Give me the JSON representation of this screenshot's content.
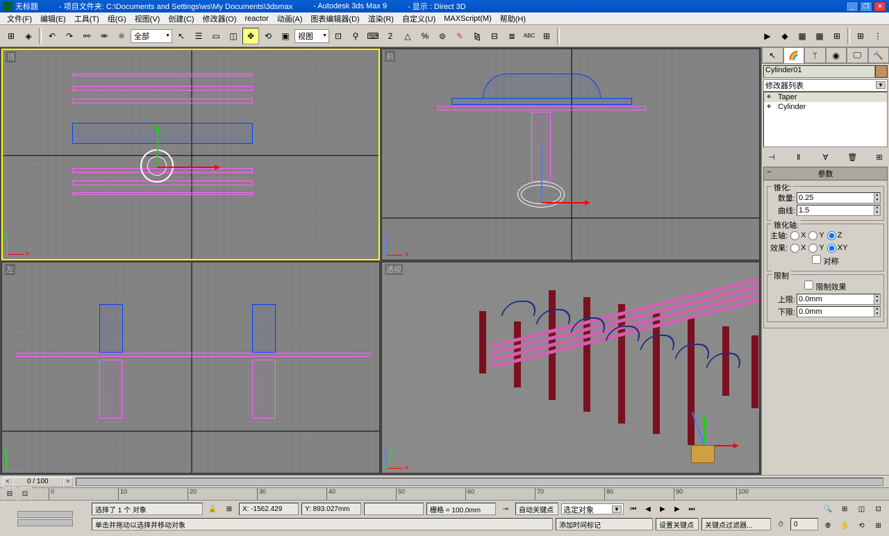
{
  "title": {
    "untitled": "无标题",
    "project": "- 项目文件夹: C:\\Documents and Settings\\ws\\My Documents\\3dsmax",
    "app": "- Autodesk 3ds Max 9",
    "display": "- 显示 : Direct 3D"
  },
  "menu": [
    "文件(F)",
    "编辑(E)",
    "工具(T)",
    "组(G)",
    "视图(V)",
    "创建(C)",
    "修改器(O)",
    "reactor",
    "动画(A)",
    "图表编辑器(D)",
    "渲染(R)",
    "自定义(U)",
    "MAXScript(M)",
    "帮助(H)"
  ],
  "toolbar": {
    "selection_set": "全部",
    "coord_sys": "视图"
  },
  "viewports": {
    "top": "顶",
    "front": "前",
    "left": "左",
    "persp": "透视"
  },
  "cmdpanel": {
    "object_name": "Cylinder01",
    "mod_dropdown": "修改器列表",
    "mods": [
      "Taper",
      "Cylinder"
    ],
    "params_title": "参数",
    "taper_group": "锥化:",
    "amount_label": "数量:",
    "amount_val": "0.25",
    "curve_label": "曲线:",
    "curve_val": "1.5",
    "axis_group": "锥化轴:",
    "primary_label": "主轴:",
    "effect_label": "效果:",
    "symmetry": "对称",
    "limit_group": "限制",
    "limit_effect": "限制效果",
    "upper_label": "上限:",
    "upper_val": "0.0mm",
    "lower_label": "下限:",
    "lower_val": "0.0mm"
  },
  "timeslider": {
    "frame": "0 / 100"
  },
  "trackticks": [
    "0",
    "10",
    "20",
    "30",
    "40",
    "50",
    "60",
    "70",
    "80",
    "90",
    "100"
  ],
  "status": {
    "sel_text": "选择了 1 个 对象",
    "prompt": "单击并拖动以选择并移动对象",
    "x": "X: -1562.429",
    "y": "Y: 893.027mm",
    "z": "",
    "grid": "栅格 = 100.0mm",
    "add_time": "添加时间标记",
    "auto_key": "自动关键点",
    "set_key": "设置关键点",
    "key_sel": "选定对象",
    "key_filter": "关键点过滤器..."
  }
}
